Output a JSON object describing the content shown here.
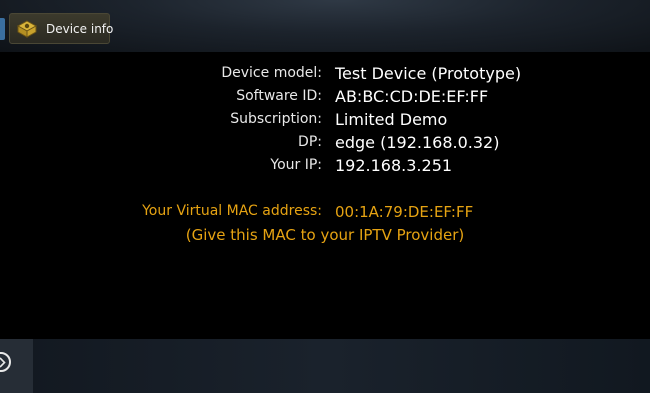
{
  "top_bar": {
    "tab": {
      "label": "Device info",
      "icon": "device-info-icon"
    }
  },
  "device_info": {
    "rows": [
      {
        "label": "Device model:",
        "value": "Test Device (Prototype)"
      },
      {
        "label": "Software ID:",
        "value": "AB:BC:CD:DE:EF:FF"
      },
      {
        "label": "Subscription:",
        "value": "Limited Demo"
      },
      {
        "label": "DP:",
        "value": "edge (192.168.0.32)"
      },
      {
        "label": "Your IP:",
        "value": "192.168.3.251"
      }
    ],
    "mac": {
      "label": "Your Virtual MAC address:",
      "value": "00:1A:79:DE:EF:FF",
      "note": "(Give this MAC to your IPTV Provider)"
    }
  },
  "bottom_bar": {
    "back_icon": "chevron-right-icon"
  },
  "colors": {
    "background": "#000000",
    "text": "#ffffff",
    "accent": "#e6a312"
  }
}
